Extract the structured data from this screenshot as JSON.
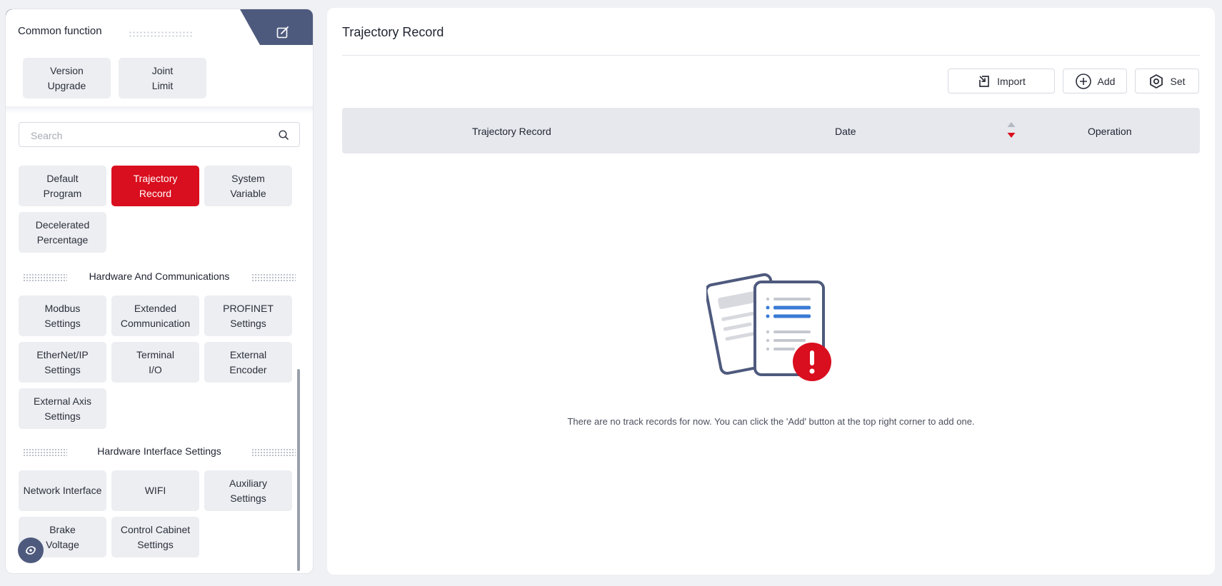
{
  "left": {
    "tab_title": "Common function",
    "upper_buttons": [
      {
        "label": "Version\nUpgrade"
      },
      {
        "label": "Joint\nLimit"
      }
    ],
    "search": {
      "placeholder": "Search"
    },
    "functions": [
      {
        "label": "Default\nProgram",
        "active": false
      },
      {
        "label": "Trajectory\nRecord",
        "active": true
      },
      {
        "label": "System\nVariable",
        "active": false
      },
      {
        "label": "Decelerated\nPercentage",
        "active": false
      }
    ],
    "sections": [
      {
        "title": "Hardware And Communications",
        "items": [
          {
            "label": "Modbus\nSettings"
          },
          {
            "label": "Extended\nCommunication"
          },
          {
            "label": "PROFINET\nSettings"
          },
          {
            "label": "EtherNet/IP\nSettings"
          },
          {
            "label": "Terminal\nI/O"
          },
          {
            "label": "External\nEncoder"
          },
          {
            "label": "External Axis\nSettings"
          }
        ]
      },
      {
        "title": "Hardware Interface Settings",
        "items": [
          {
            "label": "Network Interface"
          },
          {
            "label": "WIFI"
          },
          {
            "label": "Auxiliary\nSettings"
          },
          {
            "label": "Brake\nVoltage"
          },
          {
            "label": "Control Cabinet\nSettings"
          }
        ]
      }
    ]
  },
  "main": {
    "title": "Trajectory Record",
    "toolbar": {
      "import": "Import",
      "add": "Add",
      "set": "Set"
    },
    "table": {
      "columns": [
        "Trajectory Record",
        "Date",
        "Operation"
      ],
      "sort_colors": {
        "asc": "#b5b9c2",
        "desc": "#d90e1e"
      }
    },
    "empty_message": "There are no track records for now. You can click the 'Add' button at the top right corner to add one."
  },
  "colors": {
    "accent": "#d90e1e",
    "nav_dark": "#4e5a7d",
    "tile_bg": "#eceef2",
    "header_bg": "#e6e8ed"
  },
  "icons": [
    "edit-icon",
    "search-icon",
    "import-icon",
    "add-circle-icon",
    "settings-hex-icon",
    "sort-icon",
    "empty-document-icon",
    "assistant-icon"
  ]
}
